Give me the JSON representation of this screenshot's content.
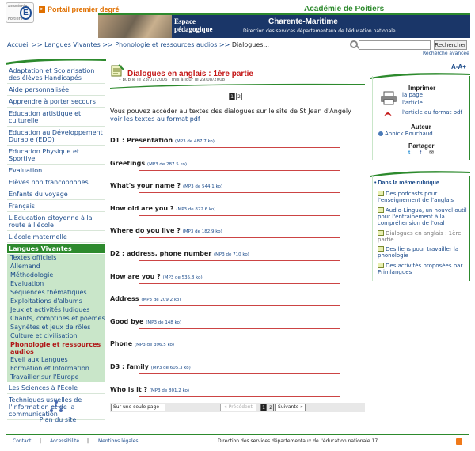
{
  "header": {
    "logo_line1": "académie",
    "logo_letter": "E",
    "logo_line2": "Poitiers",
    "portal_label": "Portail premier degré",
    "academy_title": "Académie de Poitiers",
    "banner_space": "Espace",
    "banner_pedago": "pédagogique",
    "banner_dept": "Charente-Maritime",
    "banner_direction": "Direction des services départementaux de l'éducation nationale"
  },
  "breadcrumb": {
    "home": "Accueil",
    "level1": "Langues Vivantes",
    "level2": "Phonologie et ressources audios",
    "current": "Dialogues...",
    "sep": ">>"
  },
  "search": {
    "placeholder": "",
    "button": "Rechercher",
    "advanced": "Recherche avancée"
  },
  "sidebar": {
    "items": [
      {
        "label": "Adaptation et Scolarisation des élèves Handicapés"
      },
      {
        "label": "Aide personnalisée"
      },
      {
        "label": "Apprendre à porter secours"
      },
      {
        "label": "Education artistique et culturelle"
      },
      {
        "label": "Education au Développement Durable (EDD)"
      },
      {
        "label": "Education Physique et Sportive"
      },
      {
        "label": "Evaluation"
      },
      {
        "label": "Elèves non francophones"
      },
      {
        "label": "Enfants du voyage"
      },
      {
        "label": "Français"
      },
      {
        "label": "L'Education citoyenne à la route à l'école"
      },
      {
        "label": "L'école maternelle"
      }
    ],
    "active": "Langues Vivantes",
    "subitems": [
      {
        "label": "Textes officiels"
      },
      {
        "label": "Allemand"
      },
      {
        "label": "Méthodologie"
      },
      {
        "label": "Evaluation"
      },
      {
        "label": "Séquences thématiques"
      },
      {
        "label": "Exploitations d'albums"
      },
      {
        "label": "Jeux et activités ludiques"
      },
      {
        "label": "Chants, comptines et poèmes"
      },
      {
        "label": "Saynètes et jeux de rôles"
      },
      {
        "label": "Culture et civilisation"
      },
      {
        "label": "Phonologie et ressources audios"
      },
      {
        "label": "Eveil aux Langues"
      },
      {
        "label": "Formation et Information"
      },
      {
        "label": "Travailler sur l'Europe"
      }
    ],
    "after": [
      {
        "label": "Les Sciences à l'École"
      },
      {
        "label": "Techniques usuelles de l'information et de la communication"
      }
    ],
    "plan": "Plan du site"
  },
  "article": {
    "title": "Dialogues en anglais : 1ère partie",
    "published": "publié le 23/01/2006",
    "updated": "mis à jour le 29/08/2008",
    "pages": [
      "1",
      "2"
    ],
    "intro_text": "Vous pouvez accéder au textes des dialogues sur le site de St Jean d'Angély ",
    "intro_link": "voir les textes au format pdf",
    "dialogues": [
      {
        "label": "D1 : Presentation",
        "file": "(MP3 de 487.7 ko)"
      },
      {
        "label": "Greetings",
        "file": "(MP3 de 287.5 ko)"
      },
      {
        "label": "What's your name ?",
        "file": "(MP3 de 544.1 ko)"
      },
      {
        "label": "How old are you ?",
        "file": "(MP3 de 822.6 ko)"
      },
      {
        "label": "Where do you live ?",
        "file": "(MP3 de 182.9 ko)"
      },
      {
        "label": "D2 : address, phone number",
        "file": "(MP3 de 710 ko)"
      },
      {
        "label": "How are you ?",
        "file": "(MP3 de 535.8 ko)"
      },
      {
        "label": "Address",
        "file": "(MP3 de 209.2 ko)"
      },
      {
        "label": "Good bye",
        "file": "(MP3 de 148 ko)"
      },
      {
        "label": "Phone",
        "file": "(MP3 de 396.5 ko)"
      },
      {
        "label": "D3 : family",
        "file": "(MP3 de 605.3 ko)"
      },
      {
        "label": "Who is it ?",
        "file": "(MP3 de 801.2 ko)"
      }
    ],
    "one_page": "Sur une seule page",
    "prev": "« Précédent",
    "next": "Suivante »"
  },
  "right": {
    "font_controls": "A-A+",
    "print_title": "Imprimer",
    "print_page": "la page",
    "print_article": "l'article",
    "pdf_link": "l'article au format pdf",
    "author_title": "Auteur",
    "author_name": "Annick Bouchaud",
    "share_title": "Partager",
    "share_icons": [
      "twitter-icon",
      "facebook-icon",
      "email-icon"
    ],
    "rubric_title": "Dans la même rubrique",
    "rubric_items": [
      {
        "label": "Des podcasts pour l'enseignement de l'anglais"
      },
      {
        "label": "Audio-Lingua, un nouvel outil pour l'entrainement à la compréhension de l'oral"
      },
      {
        "label": "Dialogues en anglais : 1ère partie"
      },
      {
        "label": "Des liens pour travailler la phonologie"
      },
      {
        "label": "Des activités proposées par Primlangues"
      }
    ]
  },
  "footer": {
    "contact": "Contact",
    "accessibility": "Accessibilité",
    "legal": "Mentions légales",
    "sep": "|",
    "direction": "Direction des services départementaux de l'éducation nationale 17"
  },
  "colors": {
    "accent": "#2d8a2d",
    "title_red": "#c41818",
    "link": "#1a4a8a"
  }
}
